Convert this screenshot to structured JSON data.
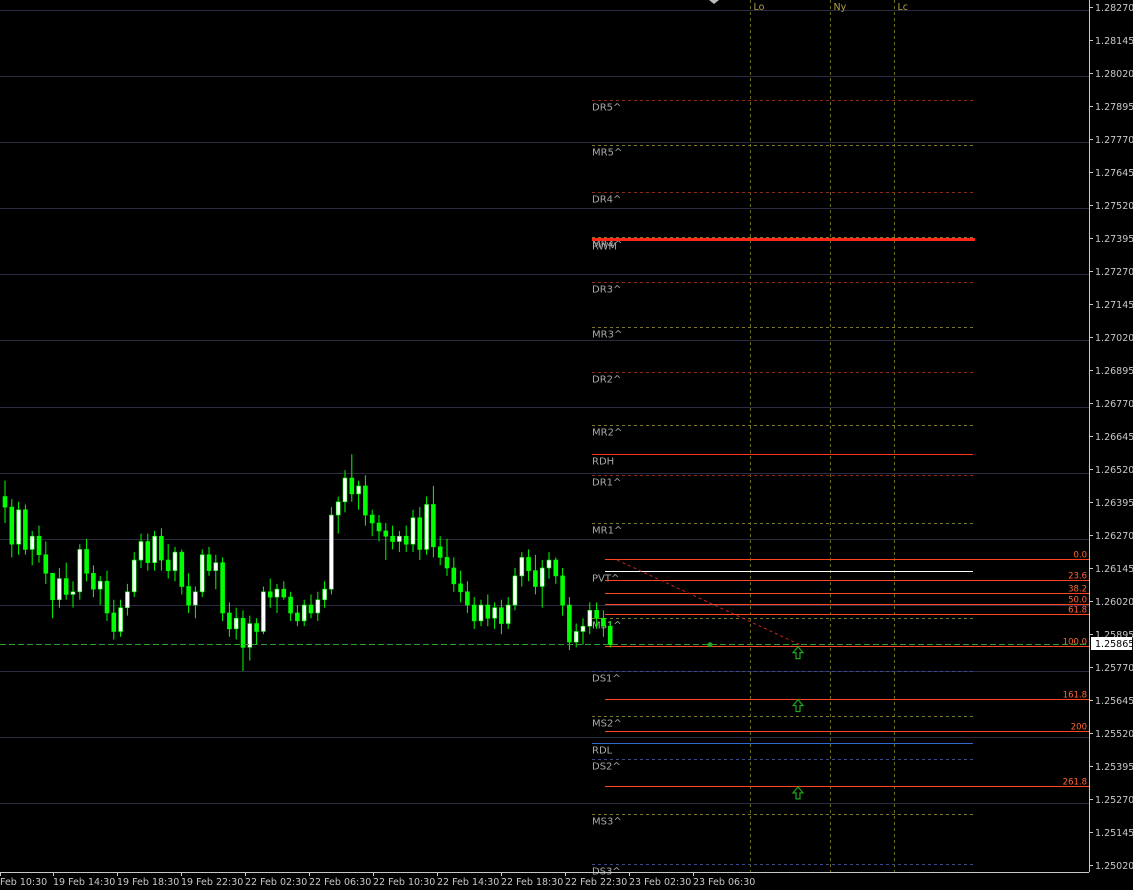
{
  "chart_data": {
    "type": "candlestick",
    "title": "",
    "xlabel": "",
    "ylabel": "",
    "ylim": [
      1.2502,
      1.2827
    ],
    "grid": true,
    "current_price": "1.25865",
    "colors": {
      "background": "#000000",
      "bull_body": "#ffffff",
      "bear_body": "#00ff00",
      "wick": "#00ff00",
      "grid": "#2a2a40",
      "axis_text": "#c8c8c8",
      "price_tag_bg": "#ffffff",
      "price_tag_text": "#000000",
      "session": "#6b6b1a",
      "level_label": "#a8a8a8",
      "mid_pivot": "#7a7a2a",
      "red_dash": "#8a2a1a",
      "blue_dash": "#3a4a8a",
      "fib": "#ff4422",
      "fib_text": "#ff6633",
      "range_high": "#ff3322",
      "range_low": "#3366cc",
      "current_line": "#2aa12a",
      "arrow": "#1aa81a"
    },
    "price_axis": {
      "ticks": [
        "1.28270",
        "1.28145",
        "1.28020",
        "1.27895",
        "1.27770",
        "1.27645",
        "1.27520",
        "1.27395",
        "1.27270",
        "1.27145",
        "1.27020",
        "1.26895",
        "1.26770",
        "1.26645",
        "1.26520",
        "1.26395",
        "1.26270",
        "1.26145",
        "1.26020",
        "1.25895",
        "1.25770",
        "1.25645",
        "1.25520",
        "1.25395",
        "1.25270",
        "1.25145",
        "1.25020"
      ]
    },
    "time_axis": {
      "labels": [
        "Feb 10:30",
        "19 Feb 14:30",
        "19 Feb 18:30",
        "19 Feb 22:30",
        "22 Feb 02:30",
        "22 Feb 06:30",
        "22 Feb 10:30",
        "22 Feb 14:30",
        "22 Feb 18:30",
        "22 Feb 22:30",
        "23 Feb 02:30",
        "23 Feb 06:30"
      ]
    },
    "sessions": [
      "Lo",
      "Ny",
      "Lc"
    ],
    "grid_prices": [
      1.2826,
      1.2801,
      1.2776,
      1.2751,
      1.2726,
      1.2701,
      1.2676,
      1.2651,
      1.2626,
      1.2601,
      1.2576,
      1.2551,
      1.2526
    ],
    "levels": [
      {
        "label": "DR5^",
        "price": 1.2792,
        "kind": "red_dash"
      },
      {
        "label": "MR5^",
        "price": 1.2775,
        "kind": "mid"
      },
      {
        "label": "DR4^",
        "price": 1.2757,
        "kind": "red_dash"
      },
      {
        "label": "MR4^",
        "price": 1.274,
        "kind": "mid"
      },
      {
        "label": "RWM",
        "price": 1.27395,
        "kind": "thick_red"
      },
      {
        "label": "DR3^",
        "price": 1.2723,
        "kind": "red_dash"
      },
      {
        "label": "MR3^",
        "price": 1.2706,
        "kind": "mid"
      },
      {
        "label": "DR2^",
        "price": 1.2689,
        "kind": "red_dash"
      },
      {
        "label": "MR2^",
        "price": 1.2669,
        "kind": "mid"
      },
      {
        "label": "RDH",
        "price": 1.2658,
        "kind": "range_high"
      },
      {
        "label": "DR1^",
        "price": 1.265,
        "kind": "red_dash"
      },
      {
        "label": "MR1^",
        "price": 1.2632,
        "kind": "mid"
      },
      {
        "label": "PVT^",
        "price": 1.2614,
        "kind": "mid"
      },
      {
        "label": "MS1^",
        "price": 1.2596,
        "kind": "mid"
      },
      {
        "label": "DS1^",
        "price": 1.2576,
        "kind": "blue_dash"
      },
      {
        "label": "MS2^",
        "price": 1.2559,
        "kind": "mid"
      },
      {
        "label": "RDL",
        "price": 1.2549,
        "kind": "range_low"
      },
      {
        "label": "DS2^",
        "price": 1.2543,
        "kind": "blue_dash"
      },
      {
        "label": "MS3^",
        "price": 1.2522,
        "kind": "mid"
      },
      {
        "label": "DS3^",
        "price": 1.2503,
        "kind": "blue_dash"
      }
    ],
    "fib": [
      {
        "label": "0.0",
        "price": 1.26185
      },
      {
        "label": "23.6",
        "price": 1.26105
      },
      {
        "label": "38.2",
        "price": 1.26055
      },
      {
        "label": "50.0",
        "price": 1.26015
      },
      {
        "label": "61.8",
        "price": 1.25975
      },
      {
        "label": "100.0",
        "price": 1.25855
      },
      {
        "label": "161.8",
        "price": 1.25655
      },
      {
        "label": "200",
        "price": 1.25535
      },
      {
        "label": "261.8",
        "price": 1.25325
      }
    ],
    "candles": [
      {
        "o": 1.2642,
        "h": 1.2648,
        "l": 1.2632,
        "c": 1.2638
      },
      {
        "o": 1.2638,
        "h": 1.2641,
        "l": 1.2619,
        "c": 1.2624
      },
      {
        "o": 1.2624,
        "h": 1.264,
        "l": 1.262,
        "c": 1.2637
      },
      {
        "o": 1.2637,
        "h": 1.2639,
        "l": 1.262,
        "c": 1.2622
      },
      {
        "o": 1.2622,
        "h": 1.2629,
        "l": 1.2616,
        "c": 1.2627
      },
      {
        "o": 1.2627,
        "h": 1.2631,
        "l": 1.2617,
        "c": 1.262
      },
      {
        "o": 1.262,
        "h": 1.2625,
        "l": 1.2609,
        "c": 1.2613
      },
      {
        "o": 1.2613,
        "h": 1.2613,
        "l": 1.2596,
        "c": 1.2603
      },
      {
        "o": 1.2603,
        "h": 1.2615,
        "l": 1.26,
        "c": 1.2611
      },
      {
        "o": 1.2611,
        "h": 1.2617,
        "l": 1.2603,
        "c": 1.2605
      },
      {
        "o": 1.2605,
        "h": 1.261,
        "l": 1.26,
        "c": 1.2606
      },
      {
        "o": 1.2606,
        "h": 1.2624,
        "l": 1.2603,
        "c": 1.2622
      },
      {
        "o": 1.2622,
        "h": 1.2626,
        "l": 1.261,
        "c": 1.2613
      },
      {
        "o": 1.2613,
        "h": 1.2616,
        "l": 1.2604,
        "c": 1.2607
      },
      {
        "o": 1.2607,
        "h": 1.2612,
        "l": 1.2601,
        "c": 1.261
      },
      {
        "o": 1.261,
        "h": 1.2614,
        "l": 1.2595,
        "c": 1.2598
      },
      {
        "o": 1.2598,
        "h": 1.2603,
        "l": 1.2588,
        "c": 1.2591
      },
      {
        "o": 1.2591,
        "h": 1.2603,
        "l": 1.2589,
        "c": 1.26
      },
      {
        "o": 1.26,
        "h": 1.2609,
        "l": 1.2597,
        "c": 1.2606
      },
      {
        "o": 1.2606,
        "h": 1.2621,
        "l": 1.2604,
        "c": 1.2618
      },
      {
        "o": 1.2618,
        "h": 1.2628,
        "l": 1.2615,
        "c": 1.2625
      },
      {
        "o": 1.2625,
        "h": 1.2628,
        "l": 1.2614,
        "c": 1.2617
      },
      {
        "o": 1.2617,
        "h": 1.2629,
        "l": 1.2614,
        "c": 1.2627
      },
      {
        "o": 1.2627,
        "h": 1.263,
        "l": 1.2614,
        "c": 1.2618
      },
      {
        "o": 1.2618,
        "h": 1.2624,
        "l": 1.2611,
        "c": 1.2614
      },
      {
        "o": 1.2614,
        "h": 1.2623,
        "l": 1.261,
        "c": 1.2621
      },
      {
        "o": 1.2621,
        "h": 1.2622,
        "l": 1.2605,
        "c": 1.2608
      },
      {
        "o": 1.2608,
        "h": 1.2613,
        "l": 1.2598,
        "c": 1.2601
      },
      {
        "o": 1.2601,
        "h": 1.2608,
        "l": 1.2596,
        "c": 1.2606
      },
      {
        "o": 1.2606,
        "h": 1.2622,
        "l": 1.2604,
        "c": 1.262
      },
      {
        "o": 1.262,
        "h": 1.2623,
        "l": 1.2612,
        "c": 1.2614
      },
      {
        "o": 1.2614,
        "h": 1.262,
        "l": 1.2607,
        "c": 1.2617
      },
      {
        "o": 1.2617,
        "h": 1.2619,
        "l": 1.2595,
        "c": 1.2598
      },
      {
        "o": 1.2598,
        "h": 1.2602,
        "l": 1.2589,
        "c": 1.2592
      },
      {
        "o": 1.2592,
        "h": 1.26,
        "l": 1.2588,
        "c": 1.2596
      },
      {
        "o": 1.2596,
        "h": 1.2599,
        "l": 1.2576,
        "c": 1.2585
      },
      {
        "o": 1.2585,
        "h": 1.2597,
        "l": 1.258,
        "c": 1.2594
      },
      {
        "o": 1.2594,
        "h": 1.2596,
        "l": 1.2586,
        "c": 1.2591
      },
      {
        "o": 1.2591,
        "h": 1.2608,
        "l": 1.259,
        "c": 1.2606
      },
      {
        "o": 1.2606,
        "h": 1.2611,
        "l": 1.26,
        "c": 1.2604
      },
      {
        "o": 1.2604,
        "h": 1.2609,
        "l": 1.2598,
        "c": 1.2607
      },
      {
        "o": 1.2607,
        "h": 1.261,
        "l": 1.2603,
        "c": 1.2604
      },
      {
        "o": 1.2604,
        "h": 1.2606,
        "l": 1.2595,
        "c": 1.2598
      },
      {
        "o": 1.2598,
        "h": 1.2601,
        "l": 1.2593,
        "c": 1.2595
      },
      {
        "o": 1.2595,
        "h": 1.2603,
        "l": 1.2593,
        "c": 1.2601
      },
      {
        "o": 1.2601,
        "h": 1.2605,
        "l": 1.2596,
        "c": 1.2598
      },
      {
        "o": 1.2598,
        "h": 1.2606,
        "l": 1.2595,
        "c": 1.2603
      },
      {
        "o": 1.2603,
        "h": 1.261,
        "l": 1.26,
        "c": 1.2607
      },
      {
        "o": 1.2607,
        "h": 1.2638,
        "l": 1.2605,
        "c": 1.2635
      },
      {
        "o": 1.2635,
        "h": 1.2642,
        "l": 1.2628,
        "c": 1.264
      },
      {
        "o": 1.264,
        "h": 1.2652,
        "l": 1.2636,
        "c": 1.2649
      },
      {
        "o": 1.2649,
        "h": 1.2658,
        "l": 1.264,
        "c": 1.2643
      },
      {
        "o": 1.2643,
        "h": 1.2648,
        "l": 1.2637,
        "c": 1.2646
      },
      {
        "o": 1.2646,
        "h": 1.265,
        "l": 1.2631,
        "c": 1.2635
      },
      {
        "o": 1.2635,
        "h": 1.2637,
        "l": 1.2627,
        "c": 1.2632
      },
      {
        "o": 1.2632,
        "h": 1.2635,
        "l": 1.2625,
        "c": 1.2629
      },
      {
        "o": 1.2629,
        "h": 1.2632,
        "l": 1.2618,
        "c": 1.2627
      },
      {
        "o": 1.2627,
        "h": 1.2631,
        "l": 1.2622,
        "c": 1.2625
      },
      {
        "o": 1.2625,
        "h": 1.2629,
        "l": 1.2621,
        "c": 1.2627
      },
      {
        "o": 1.2627,
        "h": 1.2631,
        "l": 1.2621,
        "c": 1.2624
      },
      {
        "o": 1.2624,
        "h": 1.2637,
        "l": 1.2621,
        "c": 1.2634
      },
      {
        "o": 1.2634,
        "h": 1.2638,
        "l": 1.2618,
        "c": 1.2622
      },
      {
        "o": 1.2622,
        "h": 1.2642,
        "l": 1.262,
        "c": 1.2639
      },
      {
        "o": 1.2639,
        "h": 1.2646,
        "l": 1.2619,
        "c": 1.2623
      },
      {
        "o": 1.2623,
        "h": 1.2627,
        "l": 1.2616,
        "c": 1.2619
      },
      {
        "o": 1.2619,
        "h": 1.2626,
        "l": 1.2612,
        "c": 1.2615
      },
      {
        "o": 1.2615,
        "h": 1.2619,
        "l": 1.2606,
        "c": 1.2609
      },
      {
        "o": 1.2609,
        "h": 1.2614,
        "l": 1.2602,
        "c": 1.2606
      },
      {
        "o": 1.2606,
        "h": 1.261,
        "l": 1.2598,
        "c": 1.2601
      },
      {
        "o": 1.2601,
        "h": 1.2604,
        "l": 1.2592,
        "c": 1.2595
      },
      {
        "o": 1.2595,
        "h": 1.2603,
        "l": 1.2593,
        "c": 1.2601
      },
      {
        "o": 1.2601,
        "h": 1.2605,
        "l": 1.2593,
        "c": 1.2596
      },
      {
        "o": 1.2596,
        "h": 1.2602,
        "l": 1.2592,
        "c": 1.26
      },
      {
        "o": 1.26,
        "h": 1.2603,
        "l": 1.259,
        "c": 1.2594
      },
      {
        "o": 1.2594,
        "h": 1.2604,
        "l": 1.2592,
        "c": 1.2601
      },
      {
        "o": 1.2601,
        "h": 1.2615,
        "l": 1.2599,
        "c": 1.2612
      },
      {
        "o": 1.2612,
        "h": 1.2621,
        "l": 1.2608,
        "c": 1.2619
      },
      {
        "o": 1.2619,
        "h": 1.2622,
        "l": 1.261,
        "c": 1.2614
      },
      {
        "o": 1.2614,
        "h": 1.262,
        "l": 1.2605,
        "c": 1.2608
      },
      {
        "o": 1.2608,
        "h": 1.2618,
        "l": 1.26,
        "c": 1.2615
      },
      {
        "o": 1.2615,
        "h": 1.2621,
        "l": 1.2611,
        "c": 1.2618
      },
      {
        "o": 1.2618,
        "h": 1.2619,
        "l": 1.2609,
        "c": 1.2612
      },
      {
        "o": 1.2612,
        "h": 1.2615,
        "l": 1.2597,
        "c": 1.2601
      },
      {
        "o": 1.2601,
        "h": 1.2604,
        "l": 1.2584,
        "c": 1.2587
      },
      {
        "o": 1.2587,
        "h": 1.2594,
        "l": 1.2585,
        "c": 1.2591
      },
      {
        "o": 1.2591,
        "h": 1.2596,
        "l": 1.2586,
        "c": 1.2593
      },
      {
        "o": 1.2593,
        "h": 1.2602,
        "l": 1.259,
        "c": 1.2599
      },
      {
        "o": 1.2599,
        "h": 1.2602,
        "l": 1.2592,
        "c": 1.2596
      },
      {
        "o": 1.2596,
        "h": 1.2599,
        "l": 1.2589,
        "c": 1.2593
      },
      {
        "o": 1.2593,
        "h": 1.2595,
        "l": 1.2585,
        "c": 1.2586
      }
    ]
  }
}
